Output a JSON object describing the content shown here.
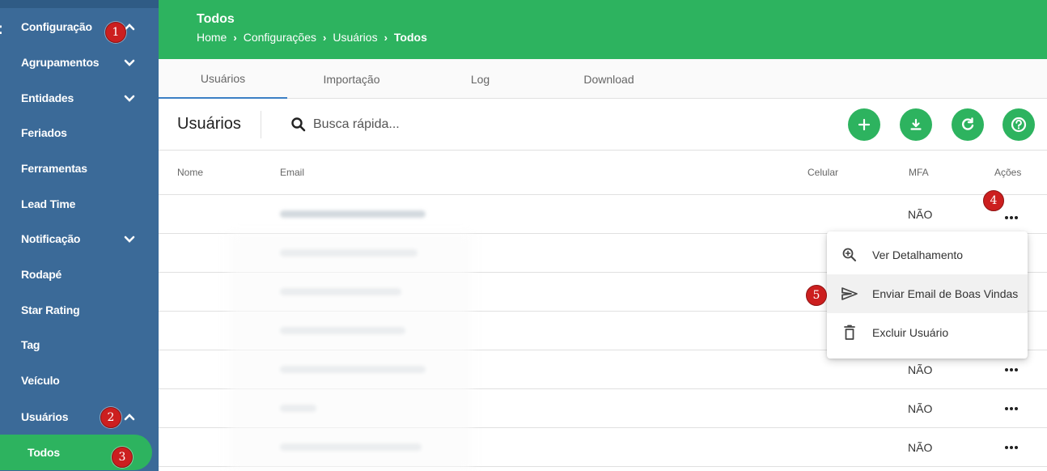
{
  "sidebar": {
    "items": [
      {
        "label": "Configuração"
      },
      {
        "label": "Agrupamentos"
      },
      {
        "label": "Entidades"
      },
      {
        "label": "Feriados"
      },
      {
        "label": "Ferramentas"
      },
      {
        "label": "Lead Time"
      },
      {
        "label": "Notificação"
      },
      {
        "label": "Rodapé"
      },
      {
        "label": "Star Rating"
      },
      {
        "label": "Tag"
      },
      {
        "label": "Veículo"
      },
      {
        "label": "Usuários"
      },
      {
        "label": "Todos"
      }
    ]
  },
  "header": {
    "title": "Todos",
    "breadcrumb": [
      "Home",
      "Configurações",
      "Usuários",
      "Todos"
    ]
  },
  "tabs": [
    {
      "label": "Usuários"
    },
    {
      "label": "Importação"
    },
    {
      "label": "Log"
    },
    {
      "label": "Download"
    }
  ],
  "toolbar": {
    "title": "Usuários",
    "search_placeholder": "Busca rápida..."
  },
  "table": {
    "columns": [
      "Nome",
      "Email",
      "Celular",
      "MFA",
      "Ações"
    ],
    "rows": [
      {
        "mfa": "NÃO"
      },
      {
        "mfa": ""
      },
      {
        "mfa": ""
      },
      {
        "mfa": ""
      },
      {
        "mfa": "NÃO"
      },
      {
        "mfa": "NÃO"
      },
      {
        "mfa": "NÃO"
      }
    ]
  },
  "menu": {
    "items": [
      {
        "label": "Ver Detalhamento",
        "icon": "zoom-in-icon"
      },
      {
        "label": "Enviar Email de Boas Vindas",
        "icon": "send-icon"
      },
      {
        "label": "Excluir Usuário",
        "icon": "trash-icon"
      }
    ]
  },
  "annotations": [
    "1",
    "2",
    "3",
    "4",
    "5"
  ],
  "colors": {
    "sidebar": "#3b6a98",
    "accent_green": "#2db35f",
    "annotation_red": "#cc1f1f",
    "tab_indicator": "#3b7fc4"
  }
}
